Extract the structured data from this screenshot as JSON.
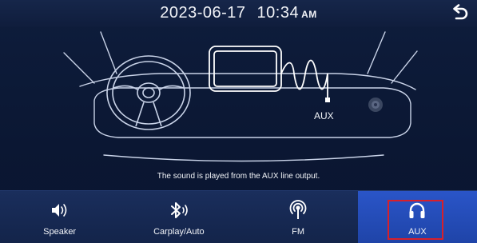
{
  "status_bar": {
    "date": "2023-06-17",
    "time": "10:34",
    "ampm": "AM"
  },
  "illustration": {
    "aux_label": "AUX",
    "caption": "The sound is played from the AUX line output."
  },
  "tabs": [
    {
      "label": "Speaker",
      "icon": "speaker-icon",
      "active": false
    },
    {
      "label": "Carplay/Auto",
      "icon": "bluetooth-icon",
      "active": false
    },
    {
      "label": "FM",
      "icon": "radio-icon",
      "active": false
    },
    {
      "label": "AUX",
      "icon": "headphones-icon",
      "active": true
    }
  ],
  "colors": {
    "background": "#0d1b36",
    "active_tab": "#2a55c8",
    "highlight_border": "#d8202a",
    "line_art": "#c9d3e8"
  }
}
